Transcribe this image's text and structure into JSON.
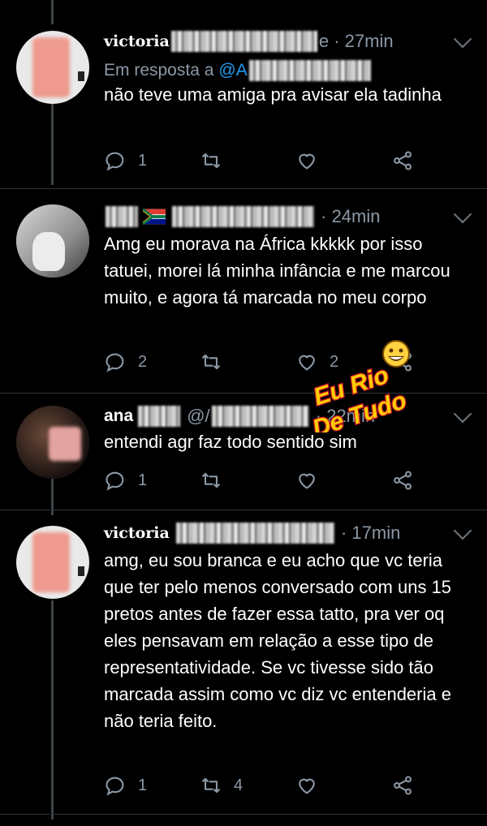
{
  "tweets": [
    {
      "name": "victoria",
      "handle_suffix": "e",
      "time": "27min",
      "reply_prefix": "Em resposta a",
      "reply_mention": "@A",
      "text": "não teve uma amiga pra avisar ela tadinha",
      "replies": "1",
      "retweets": "",
      "likes": ""
    },
    {
      "name": "",
      "time": "24min",
      "text": "Amg eu morava na África kkkkk por isso tatuei, morei lá minha infância e me marcou muito, e agora tá marcada no meu corpo",
      "replies": "2",
      "retweets": "",
      "likes": "2"
    },
    {
      "name": "ana",
      "handle_prefix": "@/",
      "time": "22min",
      "text": "entendi agr faz todo sentido sim",
      "replies": "1",
      "retweets": "",
      "likes": ""
    },
    {
      "name": "victoria",
      "time": "17min",
      "text": "amg, eu sou branca e eu acho que vc teria que ter pelo menos conversado com uns 15 pretos antes de fazer essa tatto, pra ver oq eles pensavam em relação a esse tipo de representatividade. Se vc tivesse sido tão marcada assim como vc diz vc entenderia e não teria feito.",
      "replies": "1",
      "retweets": "4",
      "likes": ""
    }
  ],
  "watermark": {
    "line1": "Eu Rio",
    "line2": "De Tudo"
  },
  "colors": {
    "background": "#000000",
    "text": "#ffffff",
    "secondary": "#8b98a5",
    "link": "#1d9bf0",
    "separator": "#2f3336"
  },
  "icons": [
    "reply-icon",
    "retweet-icon",
    "like-icon",
    "share-icon",
    "chevron-down-icon"
  ]
}
